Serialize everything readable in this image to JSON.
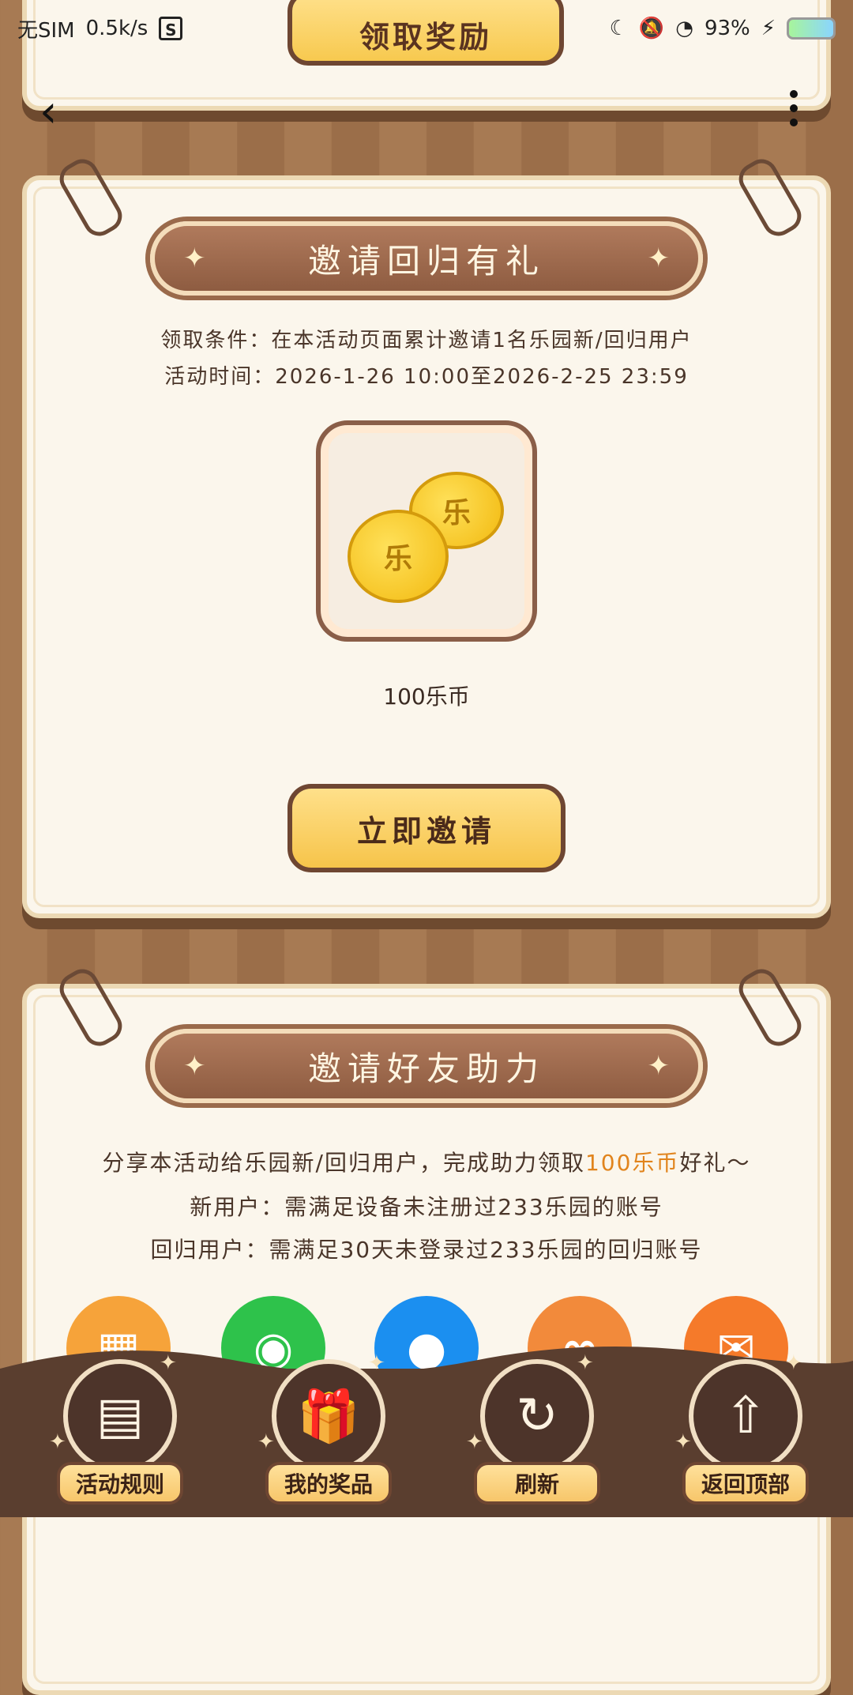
{
  "status_bar": {
    "carrier": "无SIM",
    "speed": "0.5k/s",
    "s_icon": "S",
    "battery": "93%"
  },
  "top_button_label": "领取奖励",
  "card1": {
    "title": "邀请回归有礼",
    "condition": "领取条件：在本活动页面累计邀请1名乐园新/回归用户",
    "time": "活动时间：2026-1-26 10:00至2026-2-25 23:59",
    "reward_label": "100乐币",
    "button_label": "立即邀请",
    "coin_char": "乐"
  },
  "card2": {
    "title": "邀请好友助力",
    "desc_prefix": "分享本活动给乐园新/回归用户，完成助力领取",
    "desc_highlight": "100乐币",
    "desc_suffix": "好礼～",
    "new_user": "新用户：需满足设备未注册过233乐园的账号",
    "return_user": "回归用户：需满足30天未登录过233乐园的回归账号"
  },
  "bottom_nav": [
    {
      "label": "活动规则",
      "icon": "document-icon"
    },
    {
      "label": "我的奖品",
      "icon": "gift-icon"
    },
    {
      "label": "刷新",
      "icon": "refresh-icon"
    },
    {
      "label": "返回顶部",
      "icon": "back-to-top-icon"
    }
  ],
  "colors": {
    "accent_orange": "#e1841d",
    "button_yellow": "#f7c94f",
    "banner_brown": "#8e5c41"
  }
}
